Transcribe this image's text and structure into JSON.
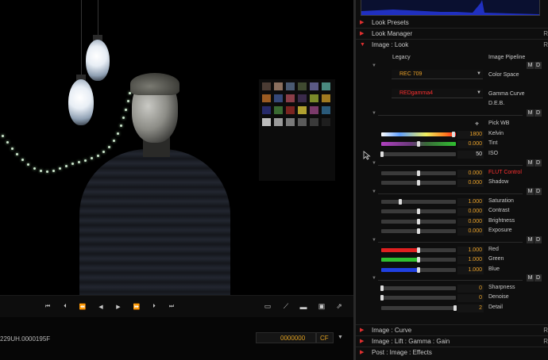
{
  "viewer": {
    "clip_name": "229UH.0000195F",
    "timecode": "0000000",
    "media": "CF",
    "transport_icons": [
      "skip-to-start-icon",
      "step-back-icon",
      "rewind-icon",
      "play-reverse-icon",
      "play-icon",
      "fast-forward-icon",
      "step-forward-icon",
      "skip-to-end-icon"
    ],
    "transport_glyphs": [
      "⏮",
      "⏴",
      "⏪",
      "◀",
      "▶",
      "⏩",
      "⏵",
      "⏭"
    ],
    "view_icons": [
      "monitor-icon",
      "stylus-icon",
      "widescreen-icon",
      "aspect-icon",
      "export-icon"
    ],
    "view_glyphs": [
      "▭",
      "⟋",
      "▬",
      "▣",
      "⇗"
    ]
  },
  "panel": {
    "sections": {
      "look_presets": "Look Presets",
      "look_manager": "Look Manager",
      "image_look": "Image : Look",
      "image_curve": "Image : Curve",
      "image_lgg": "Image : Lift : Gamma : Gain",
      "post_effects": "Post : Image : Effects",
      "r_marker": "R"
    },
    "headers": {
      "legacy": "Legacy",
      "pipeline": "Image Pipeline"
    },
    "color_space": {
      "value": "REC 709",
      "label": "Color Space"
    },
    "gamma_curve": {
      "value": "REDgamma4",
      "label": "Gamma Curve"
    },
    "deb": "D.E.B.",
    "pick_wb": "Pick WB",
    "md_labels": {
      "m": "M",
      "d": "D"
    },
    "groups": [
      [
        {
          "label": "Kelvin",
          "value": "1800",
          "level": 0.97,
          "colored": true,
          "red_label": false,
          "orange": true
        },
        {
          "label": "Tint",
          "value": "0.000",
          "level": 0.5,
          "colored": true,
          "red_label": false,
          "orange": true
        },
        {
          "label": "ISO",
          "value": "50",
          "level": 0.01,
          "colored": false,
          "red_label": false,
          "orange": false
        }
      ],
      [
        {
          "label": "FLUT Control",
          "value": "0.000",
          "level": 0.5,
          "colored": false,
          "red_label": true,
          "orange": true
        },
        {
          "label": "Shadow",
          "value": "0.000",
          "level": 0.5,
          "colored": false,
          "red_label": false,
          "orange": true
        }
      ],
      [
        {
          "label": "Saturation",
          "value": "1.000",
          "level": 0.25,
          "colored": false,
          "red_label": false,
          "orange": true
        },
        {
          "label": "Contrast",
          "value": "0.000",
          "level": 0.5,
          "colored": false,
          "red_label": false,
          "orange": true
        },
        {
          "label": "Brightness",
          "value": "0.000",
          "level": 0.5,
          "colored": false,
          "red_label": false,
          "orange": true
        },
        {
          "label": "Exposure",
          "value": "0.000",
          "level": 0.5,
          "colored": false,
          "red_label": false,
          "orange": true
        }
      ],
      [
        {
          "label": "Red",
          "value": "1.000",
          "level": 0.5,
          "colored": false,
          "red_label": false,
          "orange": true,
          "fill": "#e02020"
        },
        {
          "label": "Green",
          "value": "1.000",
          "level": 0.5,
          "colored": false,
          "red_label": false,
          "orange": true,
          "fill": "#30c030"
        },
        {
          "label": "Blue",
          "value": "1.000",
          "level": 0.5,
          "colored": false,
          "red_label": false,
          "orange": true,
          "fill": "#2040e0"
        }
      ],
      [
        {
          "label": "Sharpness",
          "value": "0",
          "level": 0.01,
          "colored": false,
          "red_label": false,
          "orange": true
        },
        {
          "label": "Denoise",
          "value": "0",
          "level": 0.01,
          "colored": false,
          "red_label": false,
          "orange": true
        },
        {
          "label": "Detail",
          "value": "2",
          "level": 0.99,
          "colored": false,
          "red_label": false,
          "orange": true
        }
      ]
    ]
  },
  "colors": {
    "accent_orange": "#e8a028",
    "accent_red": "#ff3030",
    "histogram": "#2030c0"
  }
}
